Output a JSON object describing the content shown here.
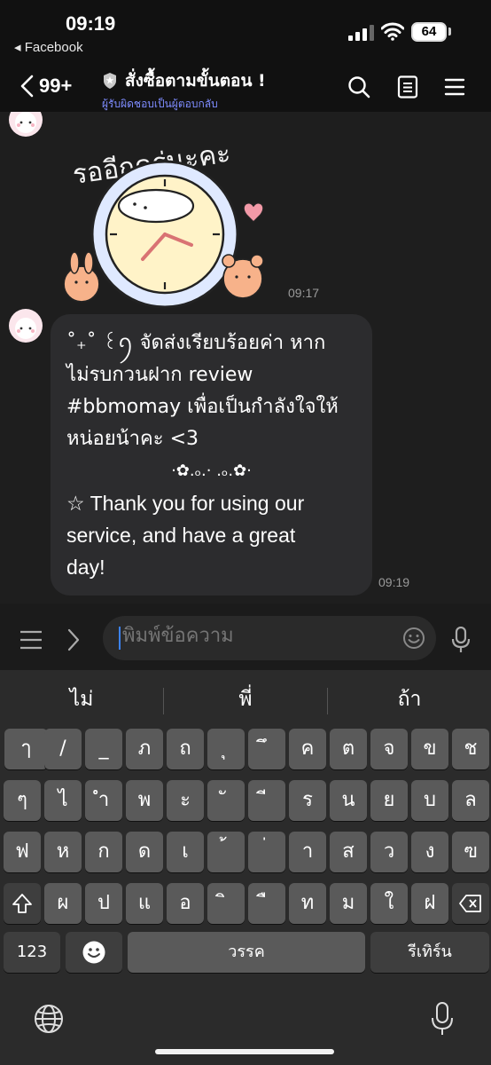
{
  "status_bar": {
    "time": "09:19",
    "back_app": "◂ Facebook",
    "battery": "64"
  },
  "header": {
    "unread_count": "99+",
    "title": "สั่งซื้อตามขั้นตอน !",
    "subtitle": "ผู้รับผิดชอบเป็นผู้ตอบกลับ",
    "icons": [
      "back-chevron-icon",
      "shield-icon",
      "search-icon",
      "notes-icon",
      "menu-icon"
    ]
  },
  "messages": [
    {
      "type": "sticker",
      "sticker_text": "รออีกครู่นะคะ",
      "time": "09:17"
    },
    {
      "type": "text",
      "lines": [
        "˚₊˚ ꒰ꪆ จัดส่งเรียบร้อยค่า หาก",
        "ไม่รบกวนฝาก review",
        "#bbmomay เพื่อเป็นกำลังใจให้",
        "หน่อยน้าคะ <3",
        "·✿.ₒ.·    .ₒ.✿·",
        "☆ Thank you for using our",
        "service, and have a great",
        "day!"
      ],
      "time": "09:19"
    }
  ],
  "input_bar": {
    "placeholder": "พิมพ์ข้อความ",
    "icons": [
      "menu-icon",
      "chevron-right-icon",
      "emoji-icon",
      "microphone-icon"
    ]
  },
  "keyboard": {
    "suggestions": [
      "ไม่",
      "พี่",
      "ถ้า"
    ],
    "row1": [
      "ๅ",
      "/",
      "_",
      "ภ",
      "ถ",
      "ุ",
      "ึ",
      "ค",
      "ต",
      "จ",
      "ข",
      "ช"
    ],
    "row2": [
      "ๆ",
      "ไ",
      "ำ",
      "พ",
      "ะ",
      "ั",
      "ี",
      "ร",
      "น",
      "ย",
      "บ",
      "ล"
    ],
    "row3": [
      "ฟ",
      "ห",
      "ก",
      "ด",
      "เ",
      "้",
      "่",
      "า",
      "ส",
      "ว",
      "ง",
      "ฃ"
    ],
    "row4": [
      "ผ",
      "ป",
      "แ",
      "อ",
      "ิ",
      "ื",
      "ท",
      "ม",
      "ใ",
      "ฝ"
    ],
    "numbers_key": "123",
    "space_key": "วรรค",
    "return_key": "รีเทิร์น",
    "icons": [
      "shift-icon",
      "backspace-icon",
      "emoji-icon",
      "globe-icon",
      "dictation-mic-icon"
    ]
  },
  "colors": {
    "accent": "#3b82f6",
    "subtitle": "#7e8cff",
    "bubble": "#2c2c2e",
    "background": "#1e1e1e"
  }
}
